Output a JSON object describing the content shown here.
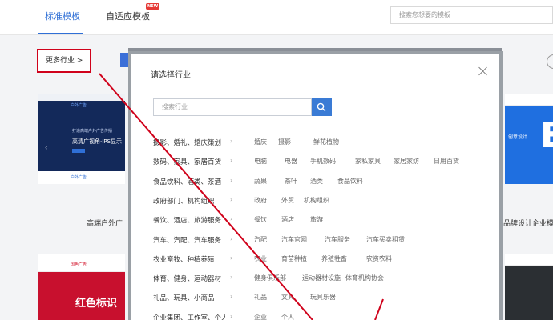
{
  "header": {
    "tab_standard": "标准模板",
    "tab_adaptive": "自适应模板",
    "new_badge": "NEW",
    "search_placeholder": "搜索您想要的模板"
  },
  "more_industries": "更多行业 >",
  "cards": {
    "tl_logo": "户外广告",
    "tl_line1": "打造高端户外广告传播",
    "tl_line2": "高清广视角·IPS显示",
    "tl_footer": "户外广告",
    "tl_title": "高端户外广",
    "tr_text": "创意设计",
    "tr_title": "品牌设计企业模板",
    "bl_logo": "国色广告",
    "bl_text": "红色标识"
  },
  "modal": {
    "title": "请选择行业",
    "search_placeholder": "搜索行业",
    "categories": [
      {
        "name": "摄影、婚礼、婚庆策划",
        "subs": [
          "婚庆",
          "摄影",
          "鲜花植物"
        ]
      },
      {
        "name": "数码、家具、家居百货",
        "subs": [
          "电脑",
          "电器",
          "手机数码",
          "家私家具",
          "家居家纺",
          "日用百货"
        ]
      },
      {
        "name": "食品饮料、酒类、茶酒",
        "subs": [
          "蔬果",
          "茶叶",
          "酒类",
          "食品饮料"
        ]
      },
      {
        "name": "政府部门、机构组织",
        "subs": [
          "政府",
          "外贸",
          "机构组织"
        ]
      },
      {
        "name": "餐饮、酒店、旅游服务",
        "subs": [
          "餐饮",
          "酒店",
          "旅游"
        ]
      },
      {
        "name": "汽车、汽配、汽车服务",
        "subs": [
          "汽配",
          "汽车官网",
          "汽车服务",
          "汽车买卖租赁"
        ]
      },
      {
        "name": "农业畜牧、种植养殖",
        "subs": [
          "农业",
          "育苗种植",
          "养殖牲畜",
          "农资农料"
        ]
      },
      {
        "name": "体育、健身、运动器材",
        "subs": [
          "健身俱乐部",
          "运动器材设施",
          "体育机构协会"
        ]
      },
      {
        "name": "礼品、玩具、小商品",
        "subs": [
          "礼品",
          "文具",
          "玩具乐器"
        ]
      },
      {
        "name": "企业集团、工作室、个人",
        "subs": [
          "企业",
          "个人"
        ]
      }
    ]
  }
}
